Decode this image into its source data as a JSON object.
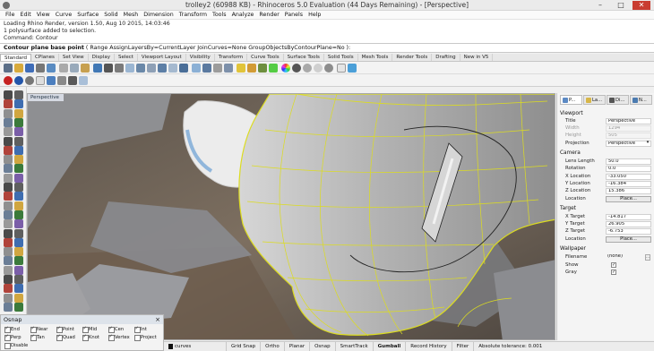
{
  "window": {
    "title": "trolley2 (60988 KB) - Rhinoceros 5.0 Evaluation (44 Days Remaining) - [Perspective]",
    "minimize_glyph": "–",
    "maximize_glyph": "□",
    "close_glyph": "✕"
  },
  "menu": [
    "File",
    "Edit",
    "View",
    "Curve",
    "Surface",
    "Solid",
    "Mesh",
    "Dimension",
    "Transform",
    "Tools",
    "Analyze",
    "Render",
    "Panels",
    "Help"
  ],
  "history": [
    "Loading Rhino Render, version 1.50, Aug 10 2015, 14:03:46",
    "1 polysurface added to selection.",
    "Command: Contour"
  ],
  "command": {
    "prompt": "Contour plane base point",
    "options": "( Range  AssignLayersBy=CurrentLayer  JoinCurves=None  GroupObjectsByContourPlane=No ):"
  },
  "toolbar_tabs": [
    "Standard",
    "CPlanes",
    "Set View",
    "Display",
    "Select",
    "Viewport Layout",
    "Visibility",
    "Transform",
    "Curve Tools",
    "Surface Tools",
    "Solid Tools",
    "Mesh Tools",
    "Render Tools",
    "Drafting",
    "New in V5"
  ],
  "viewport": {
    "label": "Perspective"
  },
  "panel": {
    "tabs": [
      "P...",
      "La...",
      "Di...",
      "N..."
    ],
    "viewport_title": "Viewport",
    "title_label": "Title",
    "title_value": "Perspective",
    "width_label": "Width",
    "width_value": "1294",
    "height_label": "Height",
    "height_value": "505",
    "projection_label": "Projection",
    "projection_value": "Perspective",
    "camera_title": "Camera",
    "lens_label": "Lens Length",
    "lens_value": "50.0",
    "rotation_label": "Rotation",
    "rotation_value": "0.0",
    "xloc_label": "X Location",
    "xloc_value": "-33.050",
    "yloc_label": "Y Location",
    "yloc_value": "-16.384",
    "zloc_label": "Z Location",
    "zloc_value": "15.386",
    "location_label": "Location",
    "place_button": "Place...",
    "target_title": "Target",
    "xt_label": "X Target",
    "xt_value": "-14.817",
    "yt_label": "Y Target",
    "yt_value": "26.905",
    "zt_label": "Z Target",
    "zt_value": "-6.753",
    "tlocation_label": "Location",
    "tplace_button": "Place...",
    "wallpaper_title": "Wallpaper",
    "filename_label": "Filename",
    "filename_value": "(none)",
    "show_label": "Show",
    "gray_label": "Gray",
    "check_glyph": "✓"
  },
  "osnap": {
    "title": "Osnap",
    "items": [
      {
        "label": "End",
        "checked": true
      },
      {
        "label": "Near",
        "checked": true
      },
      {
        "label": "Point",
        "checked": true
      },
      {
        "label": "Mid",
        "checked": true
      },
      {
        "label": "Cen",
        "checked": true
      },
      {
        "label": "Int",
        "checked": true
      },
      {
        "label": "Perp",
        "checked": true
      },
      {
        "label": "Tan",
        "checked": true
      },
      {
        "label": "Quad",
        "checked": true
      },
      {
        "label": "Knot",
        "checked": true
      },
      {
        "label": "Vertex",
        "checked": true
      },
      {
        "label": "Project",
        "checked": false
      },
      {
        "label": "Disable",
        "checked": false
      }
    ]
  },
  "status": {
    "layer": "curves",
    "items": [
      "Grid Snap",
      "Ortho",
      "Planar",
      "Osnap",
      "SmartTrack",
      "Gumball",
      "Record History",
      "Filter",
      "Absolute tolerance: 0.001"
    ],
    "active": "Gumball"
  },
  "colors": {
    "accent": "#c8c800",
    "wire": "#e4e21a",
    "surface": "#b9b9b9"
  }
}
